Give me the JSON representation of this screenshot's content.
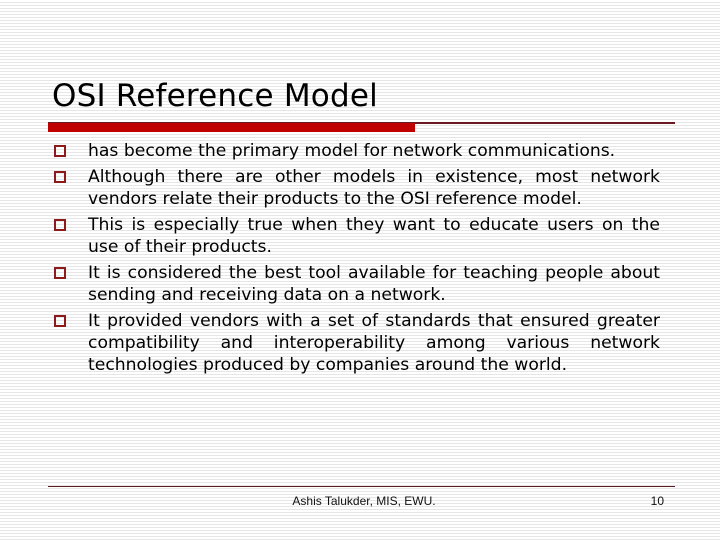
{
  "slide": {
    "title": "OSI Reference Model",
    "bullets": [
      "has become the primary model for network communications.",
      "Although there are other models in existence, most network vendors relate their products to the OSI reference model.",
      "This is especially true when they want to educate users on the use of their products.",
      "It is considered the best tool available for teaching people about sending and receiving data on a network.",
      "It provided vendors with a set of standards that ensured greater compatibility and interoperability among various network technologies produced by companies around the world."
    ],
    "bullet_icon": "hollow-square-icon",
    "footer": {
      "author": "Ashis Talukder, MIS, EWU.",
      "page_number": "10"
    }
  },
  "colors": {
    "accent_bar": "#c00000",
    "bullet": "#8b1a1a",
    "rule_line": "#6b1a24"
  }
}
